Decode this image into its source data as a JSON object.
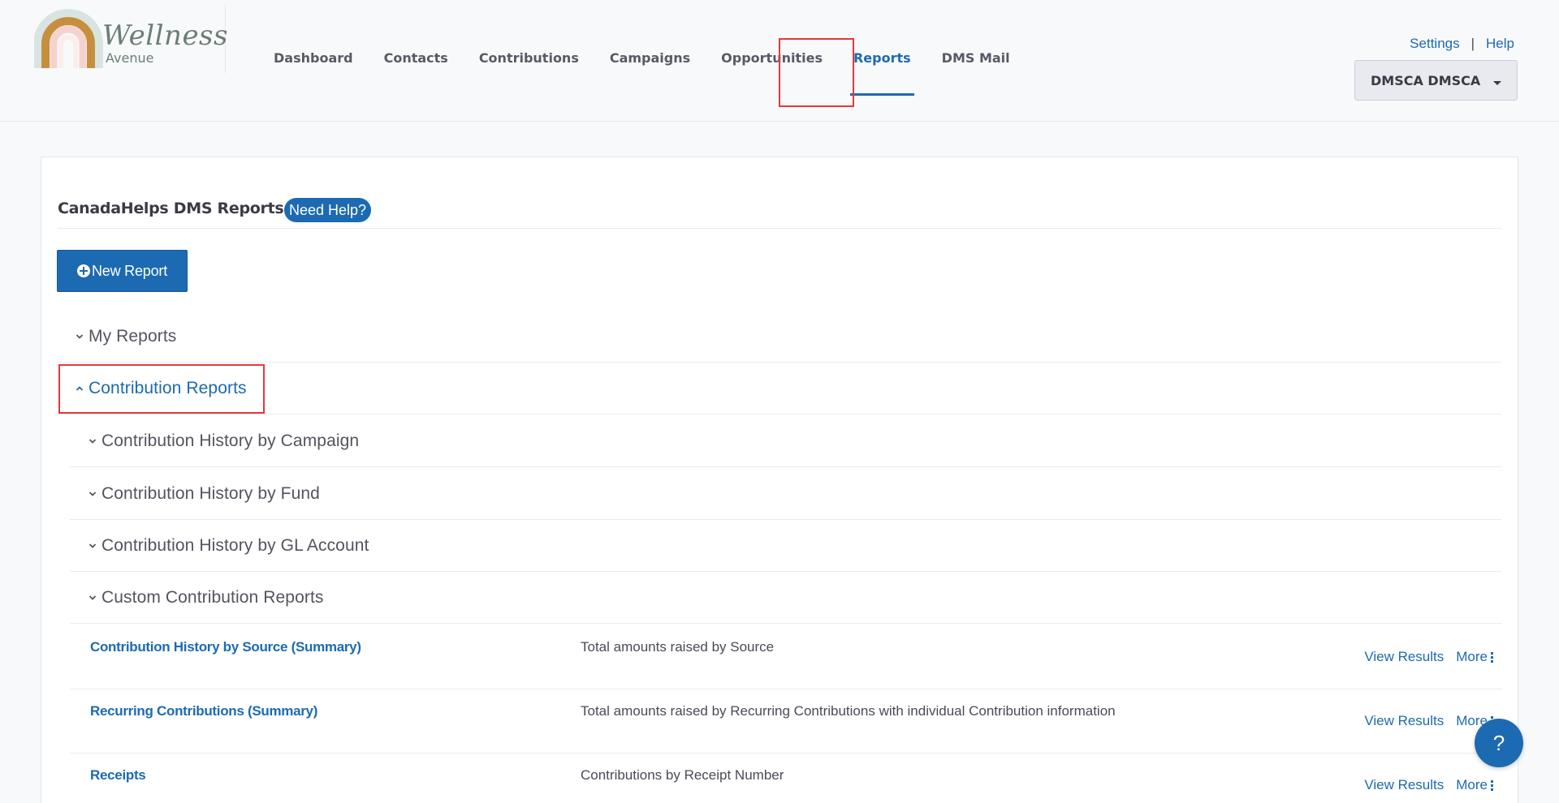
{
  "brand": {
    "name": "Wellness",
    "sub": "Avenue",
    "colors": {
      "primary": "#1c6ab2",
      "highlight": "#e03a3e",
      "logo_text": "#6c7e74"
    }
  },
  "nav": {
    "items": [
      {
        "label": "Dashboard"
      },
      {
        "label": "Contacts"
      },
      {
        "label": "Contributions"
      },
      {
        "label": "Campaigns"
      },
      {
        "label": "Opportunities"
      },
      {
        "label": "Reports",
        "active": true
      },
      {
        "label": "DMS Mail"
      }
    ]
  },
  "top_links": {
    "settings": "Settings",
    "separator": "|",
    "help": "Help"
  },
  "user_menu": {
    "label": "DMSCA DMSCA",
    "icon": "caret-down-icon"
  },
  "page": {
    "title": "CanadaHelps DMS Reports",
    "help_badge": "Need Help?",
    "new_report_label": "New Report",
    "new_report_icon": "plus-circle-icon"
  },
  "sections": {
    "my_reports": {
      "label": "My Reports",
      "expanded": false
    },
    "contribution_reports": {
      "label": "Contribution Reports",
      "expanded": true
    }
  },
  "subsections": [
    {
      "label": "Contribution History by Campaign"
    },
    {
      "label": "Contribution History by Fund"
    },
    {
      "label": "Contribution History by GL Account"
    },
    {
      "label": "Custom Contribution Reports"
    }
  ],
  "reports": [
    {
      "name": "Contribution History by Source (Summary)",
      "description": "Total amounts raised by Source",
      "view_label": "View Results",
      "more_label": "More"
    },
    {
      "name": "Recurring Contributions (Summary)",
      "description": "Total amounts raised by Recurring Contributions with individual Contribution information",
      "view_label": "View Results",
      "more_label": "More"
    },
    {
      "name": "Receipts",
      "description": "Contributions by Receipt Number",
      "view_label": "View Results",
      "more_label": "More"
    }
  ],
  "help_fab": {
    "label": "?"
  }
}
